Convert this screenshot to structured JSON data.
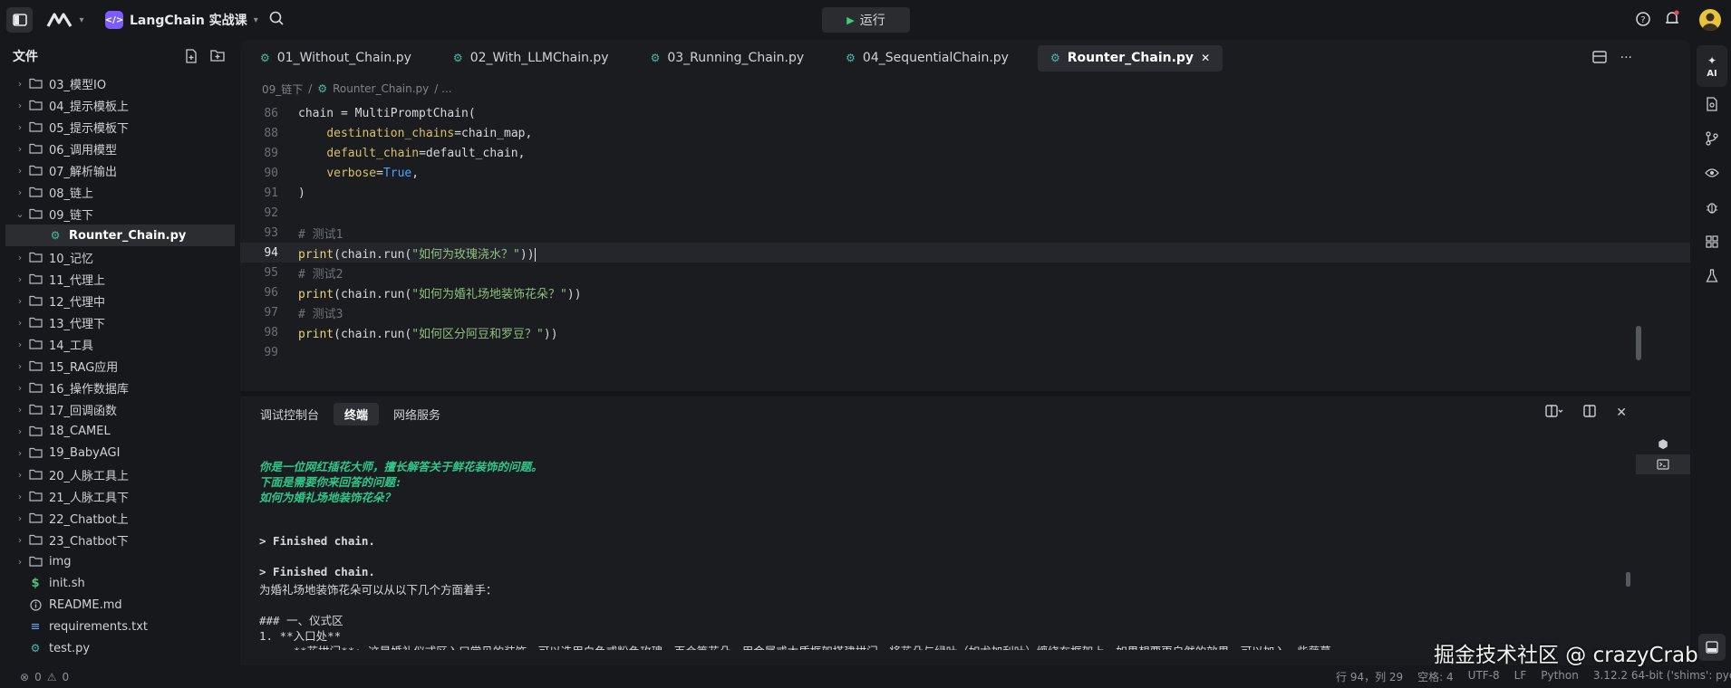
{
  "titlebar": {
    "project_name": "LangChain 实战课",
    "run_label": "运行"
  },
  "explorer": {
    "title": "文件",
    "items": [
      {
        "label": "03_模型IO",
        "type": "folder"
      },
      {
        "label": "04_提示模板上",
        "type": "folder"
      },
      {
        "label": "05_提示模板下",
        "type": "folder"
      },
      {
        "label": "06_调用模型",
        "type": "folder"
      },
      {
        "label": "07_解析输出",
        "type": "folder"
      },
      {
        "label": "08_链上",
        "type": "folder"
      },
      {
        "label": "09_链下",
        "type": "folder-open"
      },
      {
        "label": "Rounter_Chain.py",
        "type": "file-py-active"
      },
      {
        "label": "10_记忆",
        "type": "folder"
      },
      {
        "label": "11_代理上",
        "type": "folder"
      },
      {
        "label": "12_代理中",
        "type": "folder"
      },
      {
        "label": "13_代理下",
        "type": "folder"
      },
      {
        "label": "14_工具",
        "type": "folder"
      },
      {
        "label": "15_RAG应用",
        "type": "folder"
      },
      {
        "label": "16_操作数据库",
        "type": "folder"
      },
      {
        "label": "17_回调函数",
        "type": "folder"
      },
      {
        "label": "18_CAMEL",
        "type": "folder"
      },
      {
        "label": "19_BabyAGI",
        "type": "folder"
      },
      {
        "label": "20_人脉工具上",
        "type": "folder"
      },
      {
        "label": "21_人脉工具下",
        "type": "folder"
      },
      {
        "label": "22_Chatbot上",
        "type": "folder"
      },
      {
        "label": "23_Chatbot下",
        "type": "folder"
      },
      {
        "label": "img",
        "type": "folder"
      },
      {
        "label": "init.sh",
        "type": "file-sh"
      },
      {
        "label": "README.md",
        "type": "file-md"
      },
      {
        "label": "requirements.txt",
        "type": "file-txt"
      },
      {
        "label": "test.py",
        "type": "file-py"
      }
    ]
  },
  "editor": {
    "tabs": [
      {
        "label": "01_Without_Chain.py",
        "active": false
      },
      {
        "label": "02_With_LLMChain.py",
        "active": false
      },
      {
        "label": "03_Running_Chain.py",
        "active": false
      },
      {
        "label": "04_SequentialChain.py",
        "active": false
      },
      {
        "label": "Rounter_Chain.py",
        "active": true
      }
    ],
    "breadcrumb": {
      "folder": "09_链下",
      "sep": "/",
      "file": "Rounter_Chain.py",
      "tail": "/ ..."
    },
    "lines": [
      {
        "n": "86",
        "parts": [
          [
            "kw",
            "chain = MultiPromptChain("
          ]
        ]
      },
      {
        "n": "88",
        "parts": [
          [
            "kw",
            "    "
          ],
          [
            "param",
            "destination_chains"
          ],
          [
            "kw",
            "=chain_map,"
          ]
        ]
      },
      {
        "n": "89",
        "parts": [
          [
            "kw",
            "    "
          ],
          [
            "param",
            "default_chain"
          ],
          [
            "kw",
            "=default_chain,"
          ]
        ]
      },
      {
        "n": "90",
        "parts": [
          [
            "kw",
            "    "
          ],
          [
            "param",
            "verbose"
          ],
          [
            "kw",
            "="
          ],
          [
            "bool",
            "True"
          ],
          [
            "kw",
            ","
          ]
        ]
      },
      {
        "n": "91",
        "parts": [
          [
            "kw",
            ")"
          ]
        ]
      },
      {
        "n": "92",
        "parts": []
      },
      {
        "n": "93",
        "parts": [
          [
            "cmt",
            "# 测试1"
          ]
        ]
      },
      {
        "n": "94",
        "parts": [
          [
            "fn",
            "print"
          ],
          [
            "kw",
            "(chain.run("
          ],
          [
            "str",
            "\"如何为玫瑰浇水？\""
          ],
          [
            "kw",
            "))"
          ]
        ],
        "current": true
      },
      {
        "n": "95",
        "parts": [
          [
            "cmt",
            "# 测试2"
          ]
        ]
      },
      {
        "n": "96",
        "parts": [
          [
            "fn",
            "print"
          ],
          [
            "kw",
            "(chain.run("
          ],
          [
            "str",
            "\"如何为婚礼场地装饰花朵？\""
          ],
          [
            "kw",
            "))"
          ]
        ]
      },
      {
        "n": "97",
        "parts": [
          [
            "cmt",
            "# 测试3"
          ]
        ]
      },
      {
        "n": "98",
        "parts": [
          [
            "fn",
            "print"
          ],
          [
            "kw",
            "(chain.run("
          ],
          [
            "str",
            "\"如何区分阿豆和罗豆？\""
          ],
          [
            "kw",
            "))"
          ]
        ]
      },
      {
        "n": "99",
        "parts": []
      }
    ]
  },
  "panel": {
    "tabs": [
      {
        "label": "调试控制台",
        "active": false
      },
      {
        "label": "终端",
        "active": true
      },
      {
        "label": "网络服务",
        "active": false
      }
    ],
    "terminal_lines": [
      {
        "text": "",
        "style": ""
      },
      {
        "text": "你是一位网红插花大师，擅长解答关于鲜花装饰的问题。",
        "style": "green"
      },
      {
        "text": "下面是需要你来回答的问题:",
        "style": "green"
      },
      {
        "text": "如何为婚礼场地装饰花朵？",
        "style": "green"
      },
      {
        "text": "",
        "style": ""
      },
      {
        "text": "",
        "style": ""
      },
      {
        "text": "> Finished chain.",
        "style": "bold"
      },
      {
        "text": "",
        "style": ""
      },
      {
        "text": "> Finished chain.",
        "style": "bold"
      },
      {
        "text": "为婚礼场地装饰花朵可以从以下几个方面着手：",
        "style": ""
      },
      {
        "text": "",
        "style": ""
      },
      {
        "text": "### 一、仪式区",
        "style": ""
      },
      {
        "text": "1. **入口处**",
        "style": ""
      },
      {
        "text": "   - **花拱门**: 这是婚礼仪式区入口常见的装饰。可以选用白色或粉色玫瑰、百合等花朵，用金属或木质框架搭建拱门，将花朵与绿叶（如尤加利叶）缠绕在框架上。如果想要更自然的效果，可以加入一些藤蔓",
        "style": ""
      }
    ]
  },
  "activity": {
    "ai_label": "AI"
  },
  "statusbar": {
    "errors": "0",
    "warnings": "0",
    "position": "行 94，列 29",
    "spaces": "空格: 4",
    "encoding": "UTF-8",
    "eol": "LF",
    "language": "Python",
    "interpreter": "3.12.2 64-bit ('shims': pyenv)"
  },
  "watermark": "掘金技术社区 @ crazyCrab",
  "colors": {
    "accent_purple": "#7c5cff",
    "terminal_green": "#2fc88b",
    "string_green": "#8ec07c",
    "keyword_blue": "#4fa3ff"
  }
}
